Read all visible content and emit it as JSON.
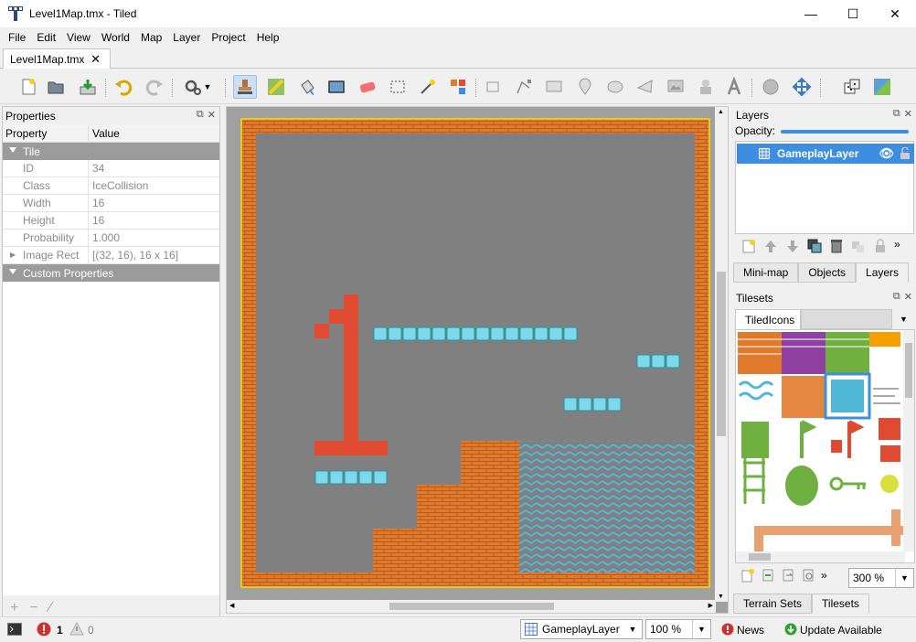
{
  "window": {
    "title": "Level1Map.tmx - Tiled",
    "minimize": "—",
    "maximize": "☐",
    "close": "✕"
  },
  "menu": [
    "File",
    "Edit",
    "View",
    "World",
    "Map",
    "Layer",
    "Project",
    "Help"
  ],
  "tabs": [
    {
      "label": "Level1Map.tmx",
      "close": "✕"
    }
  ],
  "properties": {
    "title": "Properties",
    "header": {
      "property": "Property",
      "value": "Value"
    },
    "group_tile": "Tile",
    "rows": [
      {
        "name": "ID",
        "value": "34"
      },
      {
        "name": "Class",
        "value": "IceCollision"
      },
      {
        "name": "Width",
        "value": "16"
      },
      {
        "name": "Height",
        "value": "16"
      },
      {
        "name": "Probability",
        "value": "1.000"
      },
      {
        "name": "Image Rect",
        "value": "[(32, 16), 16 x 16]"
      }
    ],
    "group_custom": "Custom Properties"
  },
  "layers_panel": {
    "title": "Layers",
    "opacity_label": "Opacity:",
    "opacity": 1.0,
    "layers": [
      {
        "name": "GameplayLayer",
        "visible": true,
        "locked": false
      }
    ],
    "tabs": [
      "Mini-map",
      "Objects",
      "Layers"
    ],
    "selected_tab": "Layers"
  },
  "tilesets_panel": {
    "title": "Tilesets",
    "tilesets": [
      "TiledIcons"
    ],
    "zoom": "300 %",
    "tabs": [
      "Terrain Sets",
      "Tilesets"
    ],
    "selected_tab": "Tilesets"
  },
  "status": {
    "errors": "1",
    "warnings": "0",
    "layer": "GameplayLayer",
    "zoom": "100 %",
    "news": "News",
    "update": "Update Available"
  },
  "colors": {
    "brick": "#e07a2c",
    "ice": "#7fd8e8",
    "red": "#e04a30",
    "water": "#4fb8d8",
    "map_bg": "#808080",
    "selection": "#3d8ee0"
  }
}
